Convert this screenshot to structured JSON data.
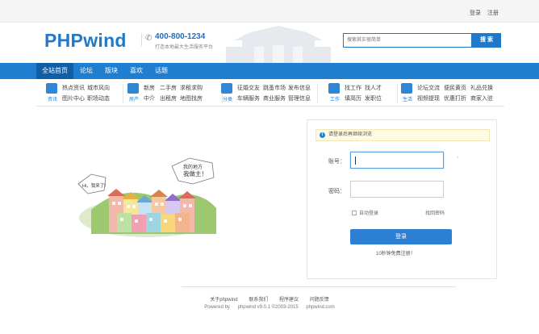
{
  "topbar": {
    "login": "登录",
    "register": "注册"
  },
  "header": {
    "logo": "PHPwind",
    "phone": "400-800-1234",
    "slogan": "打造本地最大生活服务平台",
    "search_placeholder": "搜索其实很简单",
    "search_button": "搜 索"
  },
  "nav": {
    "items": [
      {
        "label": "全站首页",
        "active": true
      },
      {
        "label": "论坛",
        "active": false
      },
      {
        "label": "版块",
        "active": false
      },
      {
        "label": "喜欢",
        "active": false
      },
      {
        "label": "话题",
        "active": false
      }
    ]
  },
  "categories": [
    {
      "icon": "news-icon",
      "label": "资讯",
      "color": "#2e86d6",
      "links": [
        "热点资讯",
        "城市风向",
        "图片中心",
        "职场动态"
      ]
    },
    {
      "icon": "house-icon",
      "label": "房产",
      "color": "#2e86d6",
      "links": [
        "新房",
        "二手房",
        "求租求购",
        "中介",
        "出租房",
        "地图找房"
      ]
    },
    {
      "icon": "category-icon",
      "label": "分类",
      "color": "#2e86d6",
      "links": [
        "征婚交友",
        "跳蚤市场",
        "发布信息",
        "车辆服务",
        "商业服务",
        "管理信息"
      ]
    },
    {
      "icon": "work-icon",
      "label": "工作",
      "color": "#2e86d6",
      "links": [
        "找工作",
        "找人才",
        "填简历",
        "发职位"
      ]
    },
    {
      "icon": "life-icon",
      "label": "生活",
      "color": "#2e86d6",
      "links": [
        "论坛交流",
        "便民黄页",
        "礼品兑换",
        "视频提现",
        "优惠打折",
        "商家入驻"
      ]
    }
  ],
  "illustration": {
    "bubble_left": "Hi，我来了！",
    "bubble_right_1": "我的地方",
    "bubble_right_2": "我做主！"
  },
  "login": {
    "notice": "请登录后再继续浏览",
    "account_label": "账号：",
    "password_label": "密码：",
    "auto_login": "自动登录",
    "forgot": "找回密码",
    "button": "登录",
    "register_text": "10秒钟免费注册！"
  },
  "footer": {
    "links": [
      "关于phpwind",
      "联系我们",
      "程序建议",
      "问题反馈"
    ],
    "powered_by": "Powered by",
    "version": "phpwind v9.0.1 ©2003-2015",
    "site": "phpwind.com"
  }
}
